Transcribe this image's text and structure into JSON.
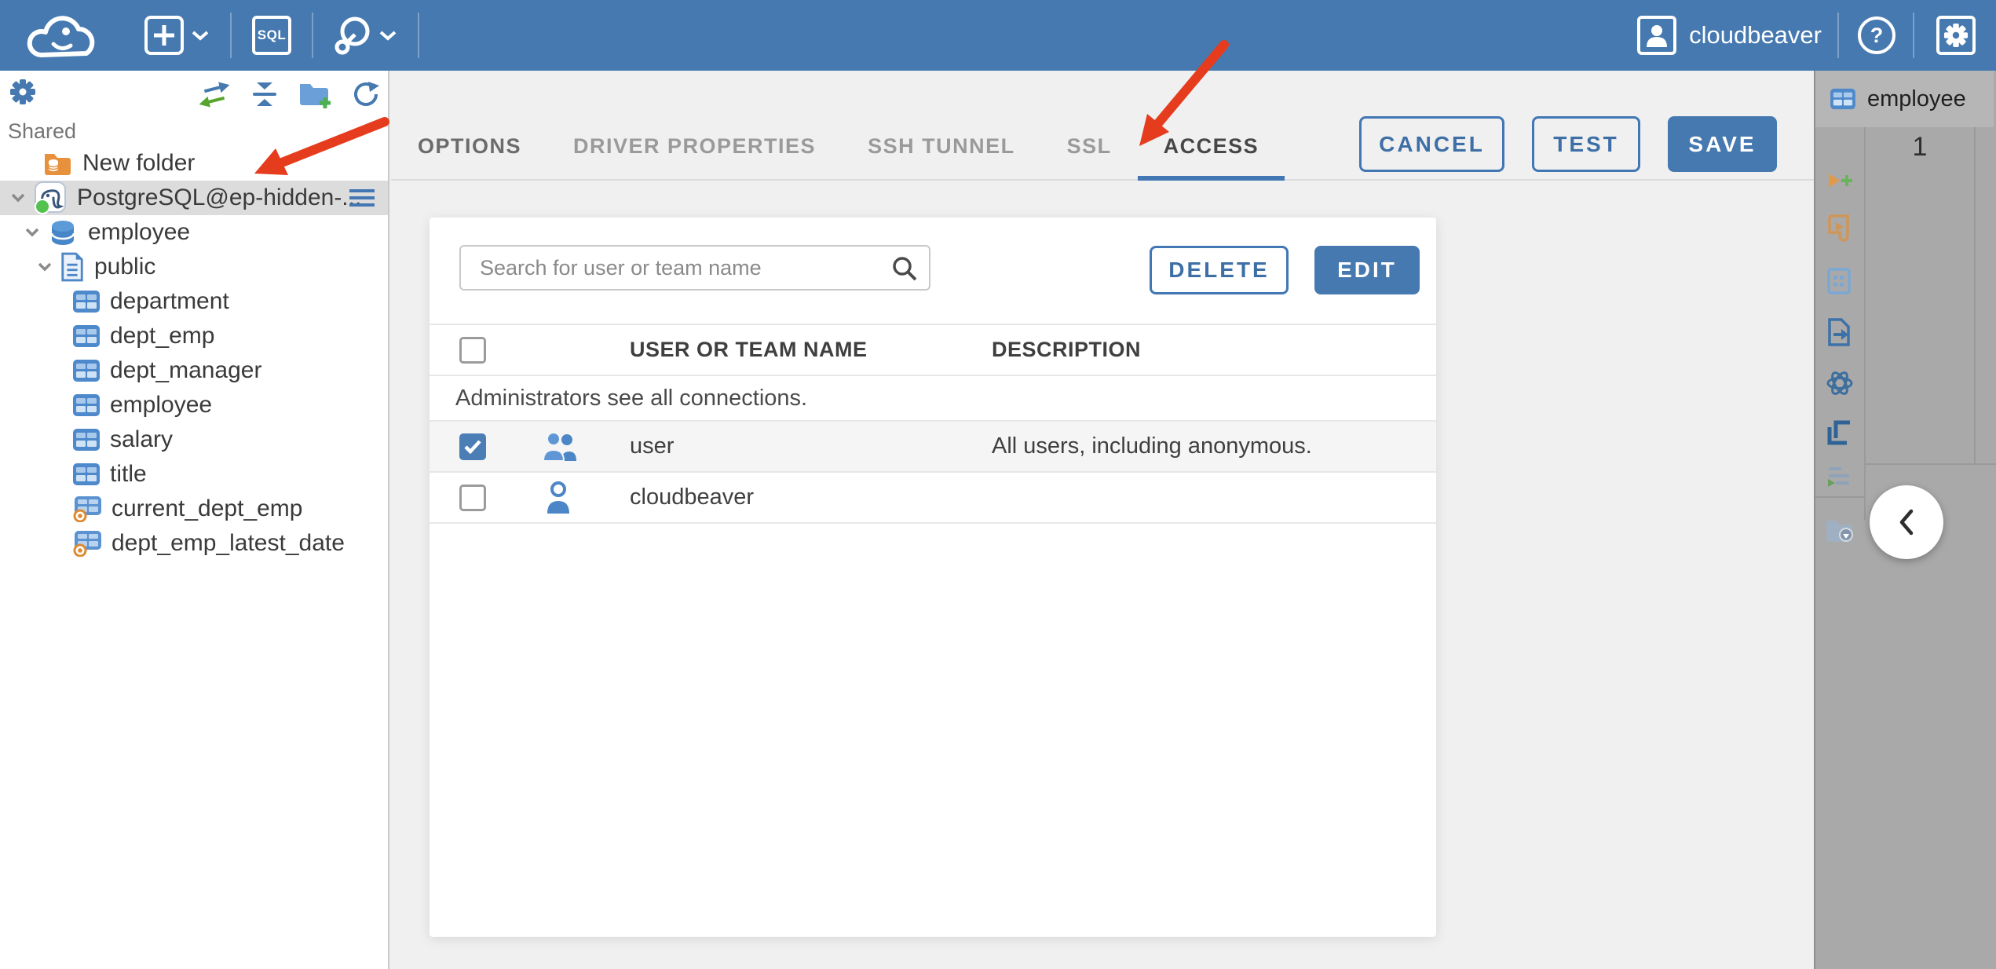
{
  "topbar": {
    "user_label": "cloudbeaver",
    "sql_button_label": "SQL",
    "help_label": "?"
  },
  "sidebar": {
    "section_label": "Shared",
    "tree": [
      {
        "label": "New folder",
        "type": "folder"
      },
      {
        "label": "PostgreSQL@ep-hidden-...",
        "type": "connection",
        "selected": true,
        "status": "connected"
      },
      {
        "label": "employee",
        "type": "database"
      },
      {
        "label": "public",
        "type": "schema"
      },
      {
        "label": "department",
        "type": "table"
      },
      {
        "label": "dept_emp",
        "type": "table"
      },
      {
        "label": "dept_manager",
        "type": "table"
      },
      {
        "label": "employee",
        "type": "table"
      },
      {
        "label": "salary",
        "type": "table"
      },
      {
        "label": "title",
        "type": "table"
      },
      {
        "label": "current_dept_emp",
        "type": "view"
      },
      {
        "label": "dept_emp_latest_date",
        "type": "view"
      }
    ]
  },
  "editor": {
    "tabs": [
      "OPTIONS",
      "DRIVER PROPERTIES",
      "SSH TUNNEL",
      "SSL",
      "ACCESS"
    ],
    "active_tab": "ACCESS",
    "cancel_label": "CANCEL",
    "test_label": "TEST",
    "save_label": "SAVE"
  },
  "access_panel": {
    "search_placeholder": "Search for user or team name",
    "delete_label": "DELETE",
    "edit_label": "EDIT",
    "columns": [
      "USER OR TEAM NAME",
      "DESCRIPTION"
    ],
    "note": "Administrators see all connections.",
    "rows": [
      {
        "name": "user",
        "description": "All users, including anonymous.",
        "type": "team",
        "checked": true
      },
      {
        "name": "cloudbeaver",
        "description": "",
        "type": "user",
        "checked": false
      }
    ]
  },
  "right_panel": {
    "tab_label": "employee",
    "row_number": "1"
  },
  "colors": {
    "topbar_blue": "#4579b0",
    "accent_blue": "#4277b4",
    "selected_row_gray": "#dcdcdc",
    "right_panel_gray": "#a9a9a9",
    "arrow_red": "#e63c1e"
  }
}
